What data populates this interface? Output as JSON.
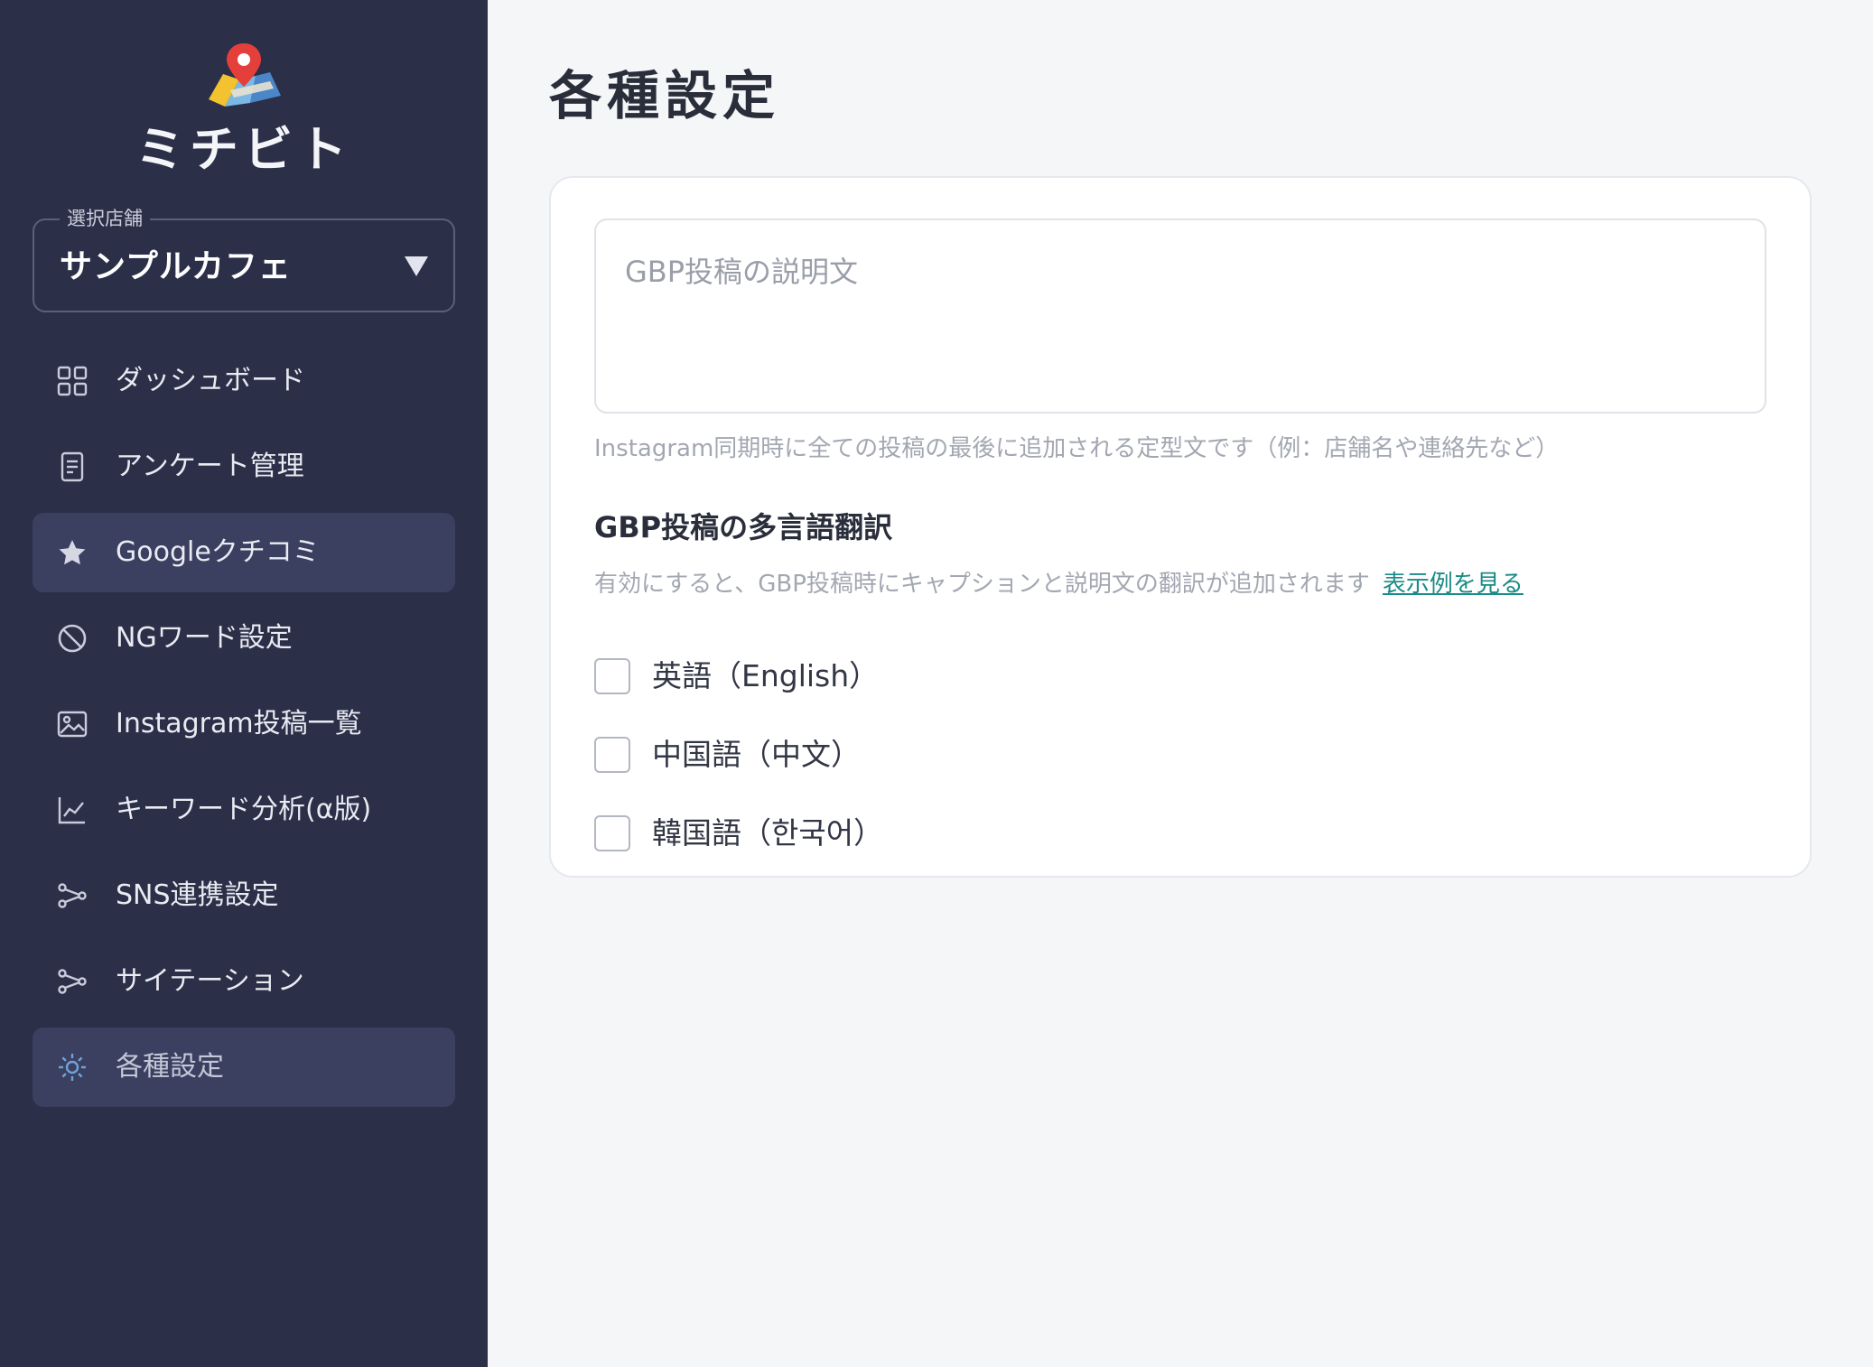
{
  "app": {
    "name": "ミチビト"
  },
  "store_select": {
    "legend": "選択店舗",
    "value": "サンプルカフェ"
  },
  "nav": {
    "items": [
      {
        "label": "ダッシュボード",
        "icon": "grid-icon"
      },
      {
        "label": "アンケート管理",
        "icon": "document-icon"
      },
      {
        "label": "Googleクチコミ",
        "icon": "star-icon"
      },
      {
        "label": "NGワード設定",
        "icon": "prohibited-icon"
      },
      {
        "label": "Instagram投稿一覧",
        "icon": "image-icon"
      },
      {
        "label": "キーワード分析(α版)",
        "icon": "line-chart-icon"
      },
      {
        "label": "SNS連携設定",
        "icon": "share-icon"
      },
      {
        "label": "サイテーション",
        "icon": "share-icon"
      },
      {
        "label": "各種設定",
        "icon": "gear-icon"
      }
    ]
  },
  "page": {
    "title": "各種設定"
  },
  "settings": {
    "description_placeholder": "GBP投稿の説明文",
    "description_helper": "Instagram同期時に全ての投稿の最後に追加される定型文です（例：店舗名や連絡先など）",
    "translation_title": "GBP投稿の多言語翻訳",
    "translation_desc": "有効にすると、GBP投稿時にキャプションと説明文の翻訳が追加されます",
    "translation_link": "表示例を見る",
    "languages": [
      {
        "label": "英語（English）",
        "checked": false
      },
      {
        "label": "中国語（中文）",
        "checked": false
      },
      {
        "label": "韓国語（한국어）",
        "checked": false
      }
    ]
  },
  "colors": {
    "sidebar_bg": "#2b2f48",
    "active_item_bg": "#3b4061",
    "link": "#1a8b86",
    "gear_accent": "#6fa3d8"
  }
}
